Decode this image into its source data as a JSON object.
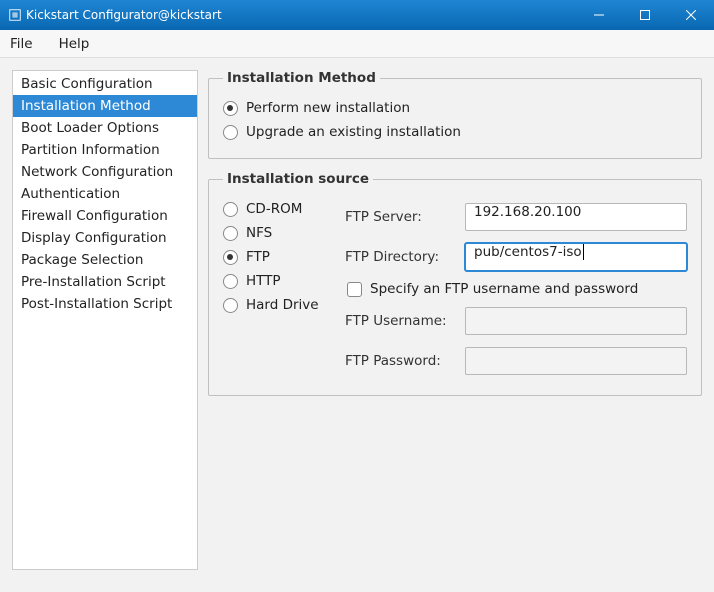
{
  "window": {
    "title": "Kickstart Configurator@kickstart"
  },
  "menubar": {
    "file": "File",
    "help": "Help"
  },
  "sidebar": {
    "items": [
      "Basic Configuration",
      "Installation Method",
      "Boot Loader Options",
      "Partition Information",
      "Network Configuration",
      "Authentication",
      "Firewall Configuration",
      "Display Configuration",
      "Package Selection",
      "Pre-Installation Script",
      "Post-Installation Script"
    ],
    "selected_index": 1
  },
  "install_method_group": {
    "legend": "Installation Method",
    "perform_label": "Perform new installation",
    "upgrade_label": "Upgrade an existing installation",
    "selected": "perform"
  },
  "install_source_group": {
    "legend": "Installation source",
    "options": {
      "cdrom": "CD-ROM",
      "nfs": "NFS",
      "ftp": "FTP",
      "http": "HTTP",
      "harddrive": "Hard Drive"
    },
    "selected": "ftp",
    "ftp_server_label": "FTP Server:",
    "ftp_server_value": "192.168.20.100",
    "ftp_dir_label": "FTP Directory:",
    "ftp_dir_value": "pub/centos7-iso",
    "ftp_cred_check_label": "Specify an FTP username and password",
    "ftp_username_label": "FTP Username:",
    "ftp_username_value": "",
    "ftp_password_label": "FTP Password:",
    "ftp_password_value": ""
  }
}
